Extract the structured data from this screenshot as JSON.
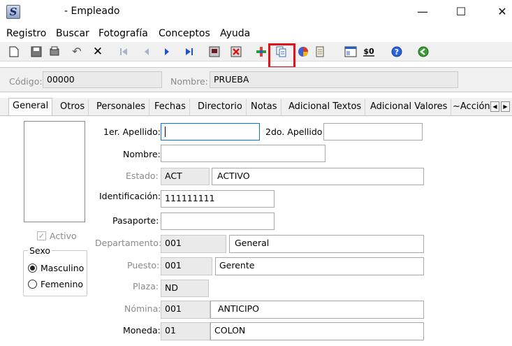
{
  "window": {
    "title": "- Empleado",
    "minimize": "—",
    "maximize": "☐",
    "close": "✕",
    "app_icon": "S"
  },
  "menu": [
    "Registro",
    "Buscar",
    "Fotografía",
    "Conceptos",
    "Ayuda"
  ],
  "header": {
    "codigo_label": "Código:",
    "codigo_value": "00000",
    "nombre_label": "Nombre:",
    "nombre_value": "PRUEBA"
  },
  "tabs": [
    "General",
    "Otros",
    "Personales",
    "Fechas",
    "Directorio",
    "Notas",
    "Adicional Textos",
    "Adicional Valores",
    "~Acción"
  ],
  "form": {
    "apellido1_label": "1er. Apellido:",
    "apellido1_value": "",
    "apellido2_label": "2do. Apellido:",
    "apellido2_value": "",
    "nombre_label": "Nombre:",
    "nombre_value": "",
    "estado_label": "Estado:",
    "estado_code": "ACT",
    "estado_desc": "ACTIVO",
    "identificacion_label": "Identificación:",
    "identificacion_value": "111111111",
    "pasaporte_label": "Pasaporte:",
    "pasaporte_value": "",
    "departamento_label": "Departamento:",
    "departamento_code": "001",
    "departamento_desc": "General",
    "puesto_label": "Puesto:",
    "puesto_code": "001",
    "puesto_desc": "Gerente",
    "plaza_label": "Plaza:",
    "plaza_code": "ND",
    "nomina_label": "Nómina:",
    "nomina_code": "001",
    "nomina_desc": "ANTICIPO",
    "moneda_label": "Moneda:",
    "moneda_code": "01",
    "moneda_desc": "COLON"
  },
  "activo_label": "Activo",
  "sexo": {
    "legend": "Sexo",
    "masculino": "Masculino",
    "femenino": "Femenino",
    "selected": "Masculino"
  },
  "colors": {
    "highlight": "#e0141b",
    "toolbar_bg": "#f0f0f0"
  }
}
